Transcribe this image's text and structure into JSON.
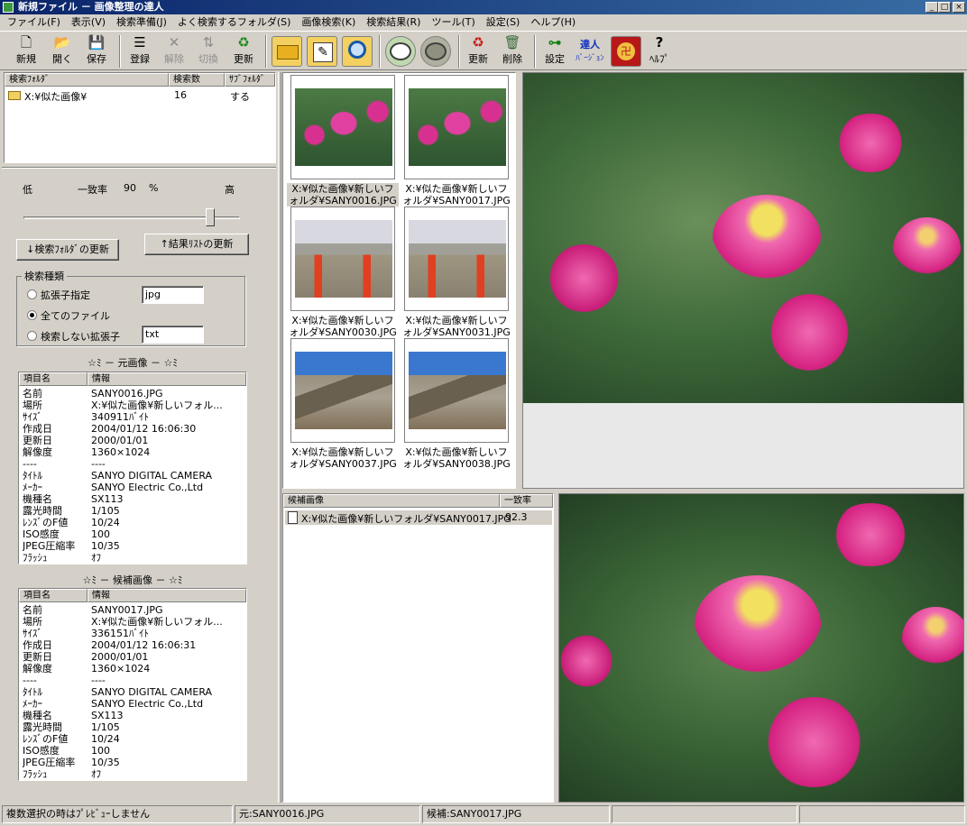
{
  "window": {
    "title": "新規ファイル － 画像整理の達人"
  },
  "menu": [
    "ファイル(F)",
    "表示(V)",
    "検索準備(J)",
    "よく検索するフォルダ(S)",
    "画像検索(K)",
    "検索結果(R)",
    "ツール(T)",
    "設定(S)",
    "ヘルプ(H)"
  ],
  "toolbar": {
    "new": "新規",
    "open": "開く",
    "save": "保存",
    "register": "登録",
    "release": "解除",
    "switch": "切換",
    "update": "更新",
    "update2": "更新",
    "delete": "削除",
    "settings": "設定",
    "tatsujin": "達人",
    "version": "ﾊﾞｰｼﾞｮﾝ",
    "help": "ﾍﾙﾌﾟ"
  },
  "folder_list": {
    "headers": [
      "検索ﾌｫﾙﾀﾞ",
      "検索数",
      "ｻﾌﾞﾌｫﾙﾀﾞ"
    ],
    "rows": [
      {
        "folder": "X:¥似た画像¥",
        "count": "16",
        "sub": "する"
      }
    ]
  },
  "slider": {
    "low": "低",
    "high": "高",
    "label": "一致率",
    "value": "90",
    "unit": "%",
    "level": 0.9
  },
  "buttons": {
    "update_folders": "↓検索ﾌｫﾙﾀﾞの更新",
    "update_results": "↑結果ﾘｽﾄの更新"
  },
  "search_type": {
    "group_label": "検索種類",
    "ext_label": "拡張子指定",
    "ext_value": "jpg",
    "all_label": "全てのファイル",
    "excl_label": "検索しない拡張子",
    "excl_value": "txt"
  },
  "source_info": {
    "title": "☆ﾐ － 元画像 － ☆ﾐ",
    "headers": [
      "項目名",
      "情報"
    ],
    "rows": [
      [
        "名前",
        "SANY0016.JPG"
      ],
      [
        "場所",
        "X:¥似た画像¥新しいフォル..."
      ],
      [
        "ｻｲｽﾞ",
        "340911ﾊﾞｲﾄ"
      ],
      [
        "作成日",
        "2004/01/12 16:06:30"
      ],
      [
        "更新日",
        "2000/01/01"
      ],
      [
        "解像度",
        "1360×1024"
      ],
      [
        "----",
        "----"
      ],
      [
        "ﾀｲﾄﾙ",
        "SANYO DIGITAL CAMERA"
      ],
      [
        "ﾒｰｶｰ",
        "SANYO Electric Co.,Ltd"
      ],
      [
        "機種名",
        "SX113"
      ],
      [
        "露光時間",
        "1/105"
      ],
      [
        "ﾚﾝｽﾞのF値",
        "10/24"
      ],
      [
        "ISO感度",
        "100"
      ],
      [
        "JPEG圧縮率",
        "10/35"
      ],
      [
        "ﾌﾗｯｼｭ",
        "ｵﾌ"
      ]
    ]
  },
  "candidate_info": {
    "title": "☆ﾐ － 候補画像 － ☆ﾐ",
    "headers": [
      "項目名",
      "情報"
    ],
    "rows": [
      [
        "名前",
        "SANY0017.JPG"
      ],
      [
        "場所",
        "X:¥似た画像¥新しいフォル..."
      ],
      [
        "ｻｲｽﾞ",
        "336151ﾊﾞｲﾄ"
      ],
      [
        "作成日",
        "2004/01/12 16:06:31"
      ],
      [
        "更新日",
        "2000/01/01"
      ],
      [
        "解像度",
        "1360×1024"
      ],
      [
        "----",
        "----"
      ],
      [
        "ﾀｲﾄﾙ",
        "SANYO DIGITAL CAMERA"
      ],
      [
        "ﾒｰｶｰ",
        "SANYO Electric Co.,Ltd"
      ],
      [
        "機種名",
        "SX113"
      ],
      [
        "露光時間",
        "1/105"
      ],
      [
        "ﾚﾝｽﾞのF値",
        "10/24"
      ],
      [
        "ISO感度",
        "100"
      ],
      [
        "JPEG圧縮率",
        "10/35"
      ],
      [
        "ﾌﾗｯｼｭ",
        "ｵﾌ"
      ]
    ]
  },
  "thumbnails": [
    {
      "label": "X:¥似た画像¥新しいフォルダ¥SANY0016.JPG",
      "kind": "flower",
      "selected": true
    },
    {
      "label": "X:¥似た画像¥新しいフォルダ¥SANY0017.JPG",
      "kind": "flower",
      "selected": false
    },
    {
      "label": "X:¥似た画像¥新しいフォルダ¥SANY0030.JPG",
      "kind": "bridge",
      "selected": false
    },
    {
      "label": "X:¥似た画像¥新しいフォルダ¥SANY0031.JPG",
      "kind": "bridge",
      "selected": false
    },
    {
      "label": "X:¥似た画像¥新しいフォルダ¥SANY0037.JPG",
      "kind": "mountain",
      "selected": false
    },
    {
      "label": "X:¥似た画像¥新しいフォルダ¥SANY0038.JPG",
      "kind": "mountain",
      "selected": false
    }
  ],
  "candidates": {
    "headers": [
      "候補画像",
      "一致率"
    ],
    "rows": [
      {
        "path": "X:¥似た画像¥新しいフォルダ¥SANY0017.JPG",
        "score": "92.3"
      }
    ]
  },
  "status": {
    "message": "複数選択の時はﾌﾟﾚﾋﾞｭｰしません",
    "source": "元:SANY0016.JPG",
    "candidate": "候補:SANY0017.JPG"
  },
  "colors": {
    "titlebar": "#0a246a",
    "face": "#d4d0c8",
    "selection": "#d4d0c8",
    "accent_red": "#d81818"
  }
}
